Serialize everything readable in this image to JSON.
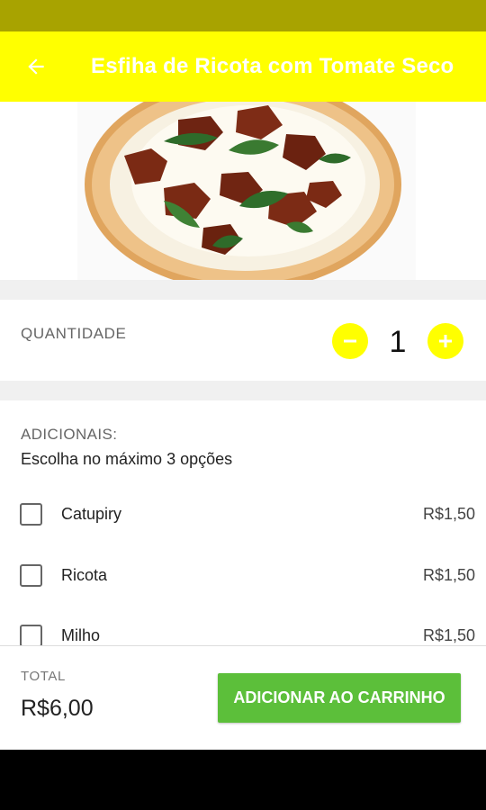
{
  "app_bar": {
    "title": "Esfiha de Ricota com Tomate Seco",
    "back_icon": "arrow-left-icon",
    "background": "#ffff00"
  },
  "status_bar": {
    "background": "#a8a300"
  },
  "product": {
    "image_alt": "pizza-photo"
  },
  "quantity": {
    "label": "QUANTIDADE",
    "value": "1",
    "minus_icon": "minus-icon",
    "plus_icon": "plus-icon"
  },
  "addons": {
    "title": "ADICIONAIS:",
    "subtitle": "Escolha no máximo 3 opções",
    "items": [
      {
        "name": "Catupiry",
        "price": "R$1,50",
        "checked": false
      },
      {
        "name": "Ricota",
        "price": "R$1,50",
        "checked": false
      },
      {
        "name": "Milho",
        "price": "R$1,50",
        "checked": false
      }
    ]
  },
  "footer": {
    "total_label": "TOTAL",
    "total_value": "R$6,00",
    "add_button": "ADICIONAR AO CARRINHO",
    "button_color": "#5cbf3a"
  }
}
